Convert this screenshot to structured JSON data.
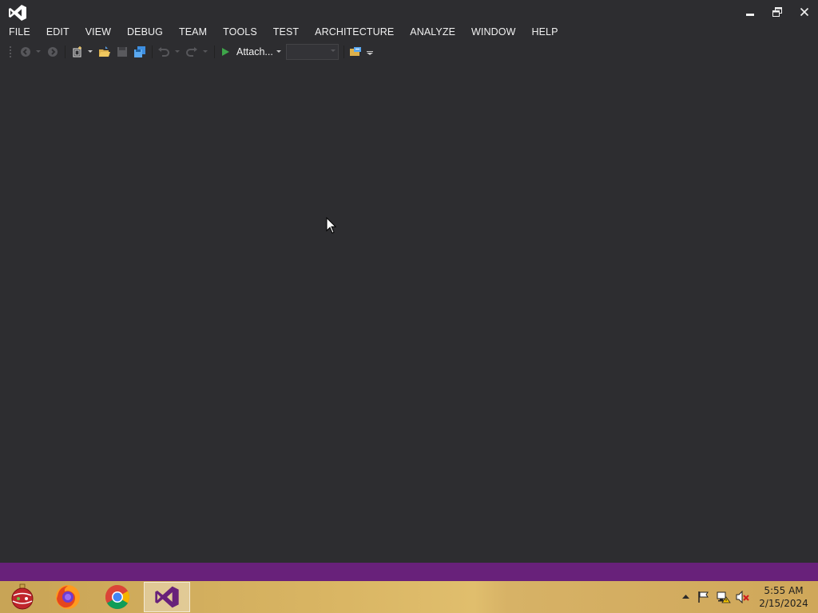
{
  "menu": {
    "items": [
      "FILE",
      "EDIT",
      "VIEW",
      "DEBUG",
      "TEAM",
      "TOOLS",
      "TEST",
      "ARCHITECTURE",
      "ANALYZE",
      "WINDOW",
      "HELP"
    ]
  },
  "toolbar": {
    "attach_label": "Attach...",
    "solution_config_value": ""
  },
  "taskbar": {
    "pinned": [
      "ornament-app-icon",
      "firefox-icon",
      "chrome-icon",
      "visual-studio-icon"
    ],
    "active": "visual-studio-icon"
  },
  "clock": {
    "time": "5:55 AM",
    "date": "2/15/2024"
  },
  "colors": {
    "editor_bg": "#2d2d30",
    "status_bar": "#68217a",
    "taskbar": "#d9b563",
    "vs_purple": "#68217a",
    "run_green": "#3ea64a"
  }
}
